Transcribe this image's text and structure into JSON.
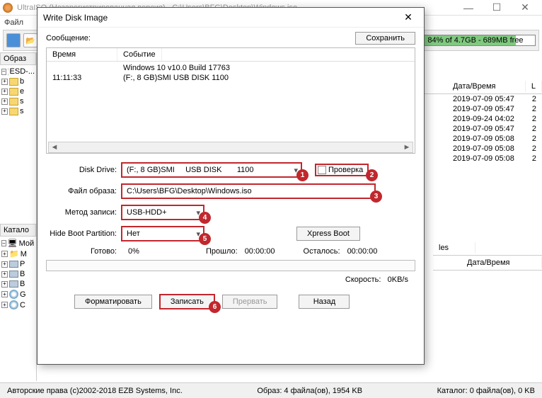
{
  "main": {
    "title": "UltraISO (Незарегистрированная версия) - C:\\Users\\BFG\\Desktop\\Windows.iso",
    "menu": [
      "Файл"
    ],
    "disk_usage": "84% of 4.7GB - 689MB free",
    "tree_header": "Образ",
    "tree_root": "ESD-...",
    "tree_items": [
      "b",
      "e",
      "s",
      "s"
    ],
    "catalog_header": "Катало",
    "my_computer": "Мой к",
    "lower_tree": [
      "M",
      "P",
      "B",
      "B",
      "G",
      "C"
    ]
  },
  "right": {
    "col_date": "Дата/Время",
    "col_l": "L",
    "rows": [
      {
        "d": "2019-07-09 05:47",
        "l": "2"
      },
      {
        "d": "2019-07-09 05:47",
        "l": "2"
      },
      {
        "d": "2019-09-24 04:02",
        "l": "2"
      },
      {
        "d": "2019-07-09 05:47",
        "l": "2"
      },
      {
        "d": "2019-07-09 05:08",
        "l": "2"
      },
      {
        "d": "2019-07-09 05:08",
        "l": "2"
      },
      {
        "d": "2019-07-09 05:08",
        "l": "2"
      }
    ],
    "lower_col_date": "Дата/Время",
    "lower_col_les": "les"
  },
  "modal": {
    "title": "Write Disk Image",
    "message_label": "Сообщение:",
    "save_btn": "Сохранить",
    "log_head_time": "Время",
    "log_head_event": "Событие",
    "log": [
      {
        "t": "",
        "e": "Windows 10 v10.0 Build 17763"
      },
      {
        "t": "11:11:33",
        "e": "(F:, 8 GB)SMI     USB DISK       1100"
      }
    ],
    "disk_drive_label": "Disk Drive:",
    "disk_drive_value": "(F:, 8 GB)SMI     USB DISK       1100",
    "verify_label": "Проверка",
    "image_file_label": "Файл образа:",
    "image_file_value": "C:\\Users\\BFG\\Desktop\\Windows.iso",
    "write_method_label": "Метод записи:",
    "write_method_value": "USB-HDD+",
    "hide_boot_label": "Hide Boot Partition:",
    "hide_boot_value": "Нет",
    "xpress_boot": "Xpress Boot",
    "done_label": "Готово:",
    "done_value": "0%",
    "elapsed_label": "Прошло:",
    "elapsed_value": "00:00:00",
    "remain_label": "Осталось:",
    "remain_value": "00:00:00",
    "speed_label": "Скорость:",
    "speed_value": "0KB/s",
    "btn_format": "Форматировать",
    "btn_write": "Записать",
    "btn_abort": "Прервать",
    "btn_back": "Назад",
    "badges": {
      "1": "1",
      "2": "2",
      "3": "3",
      "4": "4",
      "5": "5",
      "6": "6"
    }
  },
  "status": {
    "copyright": "Авторские права (c)2002-2018 EZB Systems, Inc.",
    "image": "Образ: 4 файла(ов), 1954 KB",
    "catalog": "Каталог: 0 файла(ов), 0 KB"
  }
}
